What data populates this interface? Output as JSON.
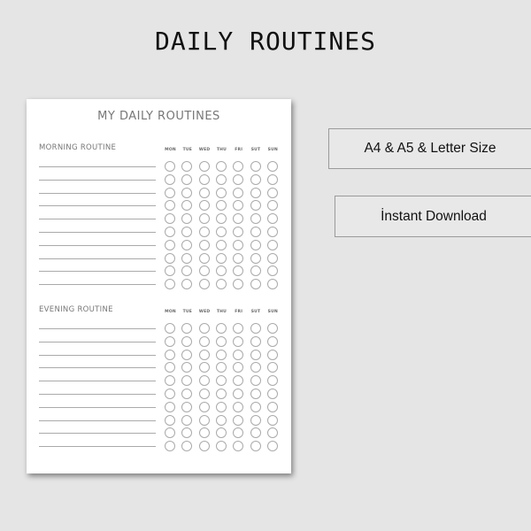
{
  "title": "DAILY ROUTINES",
  "sheet": {
    "title": "MY DAILY ROUTINES",
    "days": [
      "MON",
      "TUE",
      "WED",
      "THU",
      "FRI",
      "SUT",
      "SUN"
    ],
    "sections": [
      {
        "label": "MORNING ROUTINE",
        "rows": 10
      },
      {
        "label": "EVENING ROUTINE",
        "rows": 10
      }
    ]
  },
  "badges": {
    "sizes": "A4  &  A5  &  Letter Size",
    "download": "İnstant Download"
  }
}
